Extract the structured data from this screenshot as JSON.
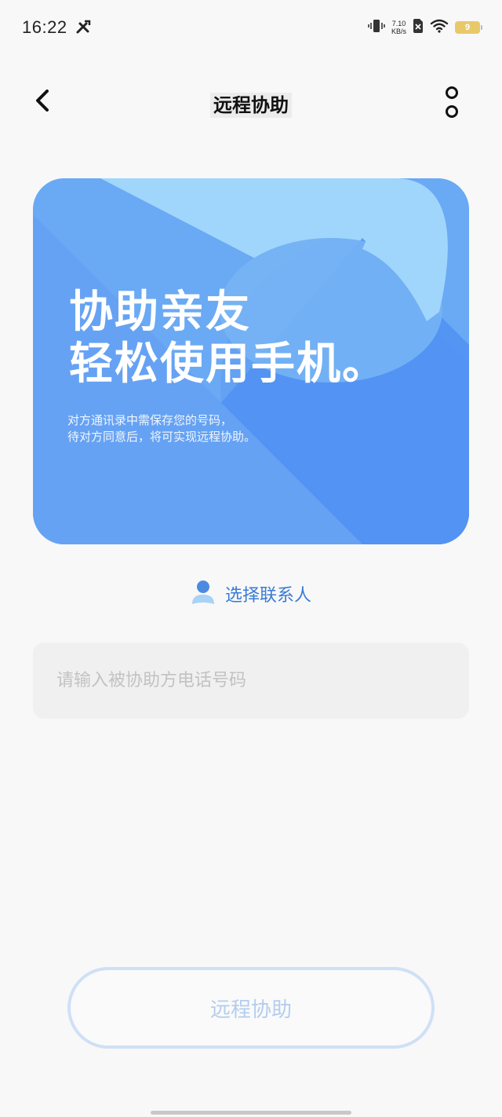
{
  "status_bar": {
    "time": "16:22",
    "net_speed_value": "7.10",
    "net_speed_unit": "KB/s",
    "battery_level": "9",
    "icons": [
      "tools-icon",
      "vibrate-icon",
      "sim-off-icon",
      "wifi-icon",
      "battery-icon"
    ]
  },
  "header": {
    "title": "远程协助",
    "back_icon": "chevron-left-icon",
    "more_icon": "more-vertical-icon"
  },
  "banner": {
    "headline_line1": "协助亲友",
    "headline_line2": "轻松使用手机。",
    "subtitle_line1": "对方通讯录中需保存您的号码，",
    "subtitle_line2": "待对方同意后，将可实现远程协助。",
    "colors": {
      "base": "#5d9bf2",
      "light": "#a0d6fb",
      "mid": "#75b3f5",
      "deep": "#5090f2"
    }
  },
  "contact_picker": {
    "label": "选择联系人",
    "icon": "person-icon",
    "color": "#3a7bd5"
  },
  "phone_input": {
    "value": "",
    "placeholder": "请输入被协助方电话号码"
  },
  "primary_button": {
    "label": "远程协助",
    "state": "disabled"
  }
}
